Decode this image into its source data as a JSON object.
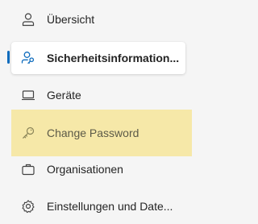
{
  "nav": {
    "items": [
      {
        "label": "Übersicht",
        "icon": "person-icon"
      },
      {
        "label": "Sicherheitsinformation...",
        "icon": "person-key-icon",
        "selected": true
      },
      {
        "label": "Geräte",
        "icon": "laptop-icon"
      },
      {
        "label": "Change Password",
        "icon": "key-icon",
        "highlighted": true
      },
      {
        "label": "Organisationen",
        "icon": "briefcase-icon"
      },
      {
        "label": "Einstellungen und Date...",
        "icon": "gear-icon"
      }
    ]
  },
  "colors": {
    "selection_indicator": "#0f6cbd",
    "highlight_background": "#f6e8a8",
    "page_background": "#f5f5f5"
  }
}
